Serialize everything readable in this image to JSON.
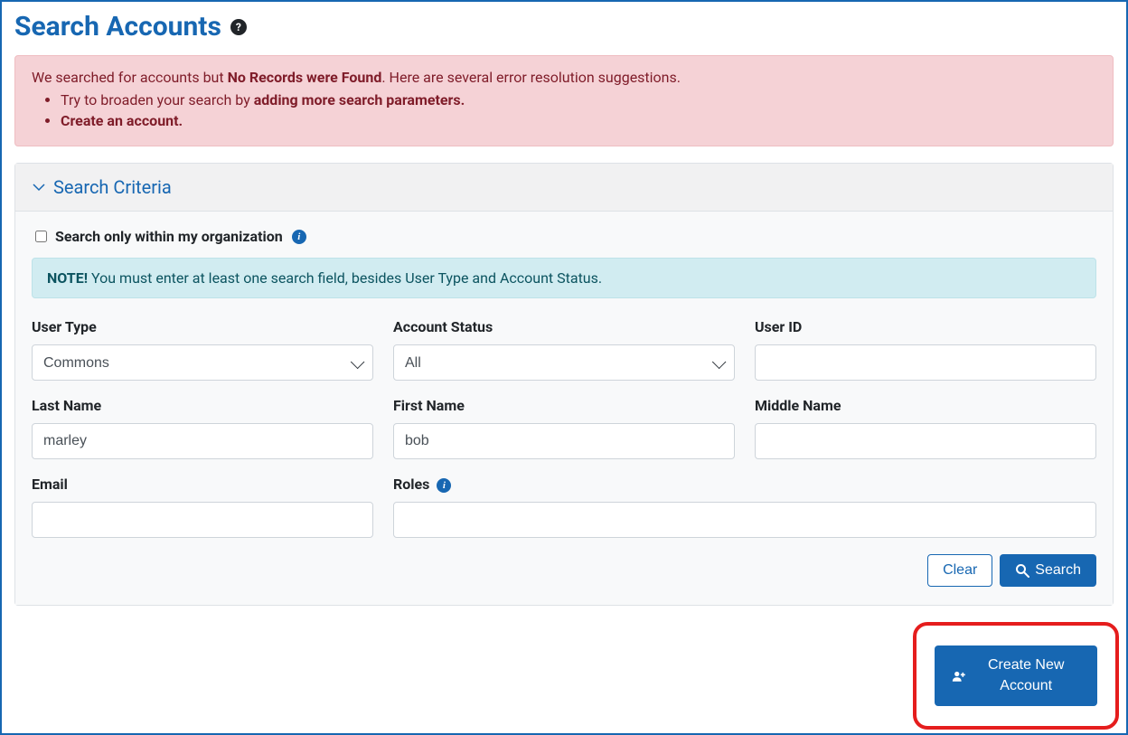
{
  "page_title": "Search Accounts",
  "error": {
    "lead_pre": "We searched for accounts but ",
    "lead_bold": "No Records were Found",
    "lead_post": ". Here are several error resolution suggestions.",
    "sugg1_pre": "Try to broaden your search by ",
    "sugg1_bold": "adding more search parameters.",
    "sugg2_link": "Create an account."
  },
  "panel_title": "Search Criteria",
  "org_checkbox_label": "Search only within my organization",
  "note_strong": "NOTE!",
  "note_text": " You must enter at least one search field, besides User Type and Account Status.",
  "fields": {
    "user_type": {
      "label": "User Type",
      "value": "Commons"
    },
    "account_status": {
      "label": "Account Status",
      "value": "All"
    },
    "user_id": {
      "label": "User ID",
      "value": ""
    },
    "last_name": {
      "label": "Last Name",
      "value": "marley"
    },
    "first_name": {
      "label": "First Name",
      "value": "bob"
    },
    "middle_name": {
      "label": "Middle Name",
      "value": ""
    },
    "email": {
      "label": "Email",
      "value": ""
    },
    "roles": {
      "label": "Roles",
      "value": ""
    }
  },
  "buttons": {
    "clear": "Clear",
    "search": "Search",
    "create_new_account": "Create New Account"
  }
}
